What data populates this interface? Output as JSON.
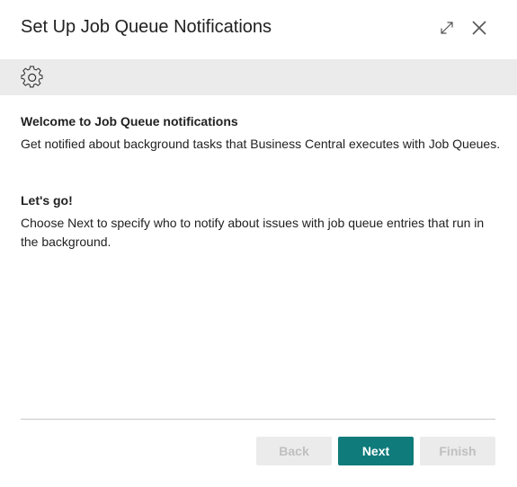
{
  "dialog": {
    "title": "Set Up Job Queue Notifications",
    "icons": {
      "expand": "expand-icon",
      "close": "close-icon",
      "banner": "gear-icon"
    }
  },
  "welcome": {
    "heading": "Welcome to Job Queue notifications",
    "text": "Get notified about background tasks that Business Central executes with Job Queues."
  },
  "letsgo": {
    "heading": "Let's go!",
    "text": "Choose Next to specify who to notify about issues with job queue entries that run in the background."
  },
  "buttons": {
    "back": "Back",
    "next": "Next",
    "finish": "Finish"
  },
  "colors": {
    "accent": "#0f7b7b",
    "disabled_bg": "#ebebeb",
    "disabled_text": "#bfbfbf"
  }
}
